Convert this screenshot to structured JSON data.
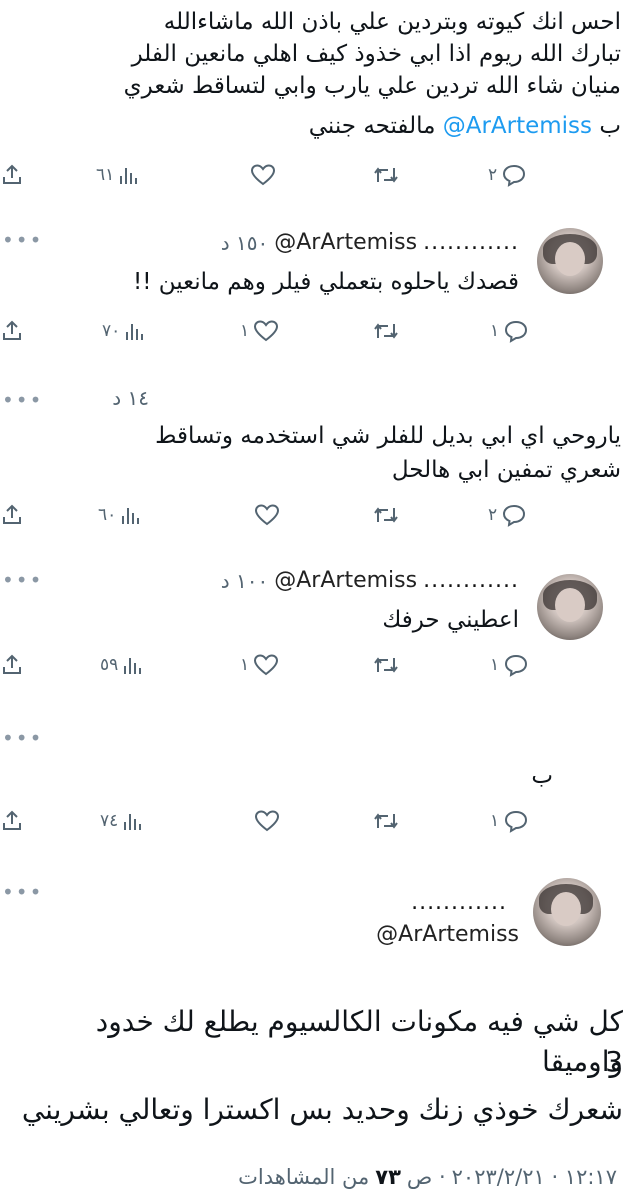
{
  "tweets": [
    {
      "id": "t1",
      "lines": [
        "احس انك كيوته وبتردين علي باذن الله ماشاءالله",
        "تبارك الله ريوم اذا ابي خذوذ كيف اهلي مانعين الفلر",
        "منيان شاء الله تردين علي يارب وابي لتساقط شعري"
      ],
      "last_line_prefix": "مالفتحه جنني",
      "mention": "@ArArtemiss",
      "last_line_suffix": "ب",
      "replies": "٢",
      "retweets": "",
      "likes": "",
      "views": "٦١"
    },
    {
      "id": "t2",
      "dots": "............",
      "handle": "@ArArtemiss",
      "time": "١٥٠ د",
      "lines": [
        "قصدك ياحلوه بتعملي فيلر وهم مانعين !!"
      ],
      "replies": "١",
      "retweets": "",
      "likes": "١",
      "views": "٧٠"
    },
    {
      "id": "t3",
      "time": "١٤ د",
      "lines": [
        "ياروحي اي ابي بديل للفلر شي استخدمه وتساقط",
        "شعري تمفين ابي هالحل"
      ],
      "replies": "٢",
      "retweets": "",
      "likes": "",
      "views": "٦٠"
    },
    {
      "id": "t4",
      "dots": "............",
      "handle": "@ArArtemiss",
      "time": "١٠٠ د",
      "lines": [
        "اعطيني حرفك"
      ],
      "replies": "١",
      "retweets": "",
      "likes": "١",
      "views": "٥٩"
    },
    {
      "id": "t5",
      "lines": [
        "ب"
      ],
      "replies": "١",
      "retweets": "",
      "likes": "",
      "views": "٧٤"
    }
  ],
  "final": {
    "dots": "............",
    "handle": "@ArArtemiss",
    "line1": "كل شي فيه مكونات الكالسيوم يطلع لك خدود واوميقا",
    "line2": "3",
    "line3": "شعرك خوذي زنك وحديد بس اكسترا وتعالي بشريني",
    "footer_date": "١٢:١٧ · ٢٠٢٣/٢/٢١",
    "footer_sep": "ص ·",
    "footer_views": "٧٣",
    "footer_views_label": "من المشاهدات"
  },
  "more_label": "•••",
  "colors": {
    "text": "#0f1419",
    "muted": "#536471",
    "link": "#1d9bf0"
  }
}
